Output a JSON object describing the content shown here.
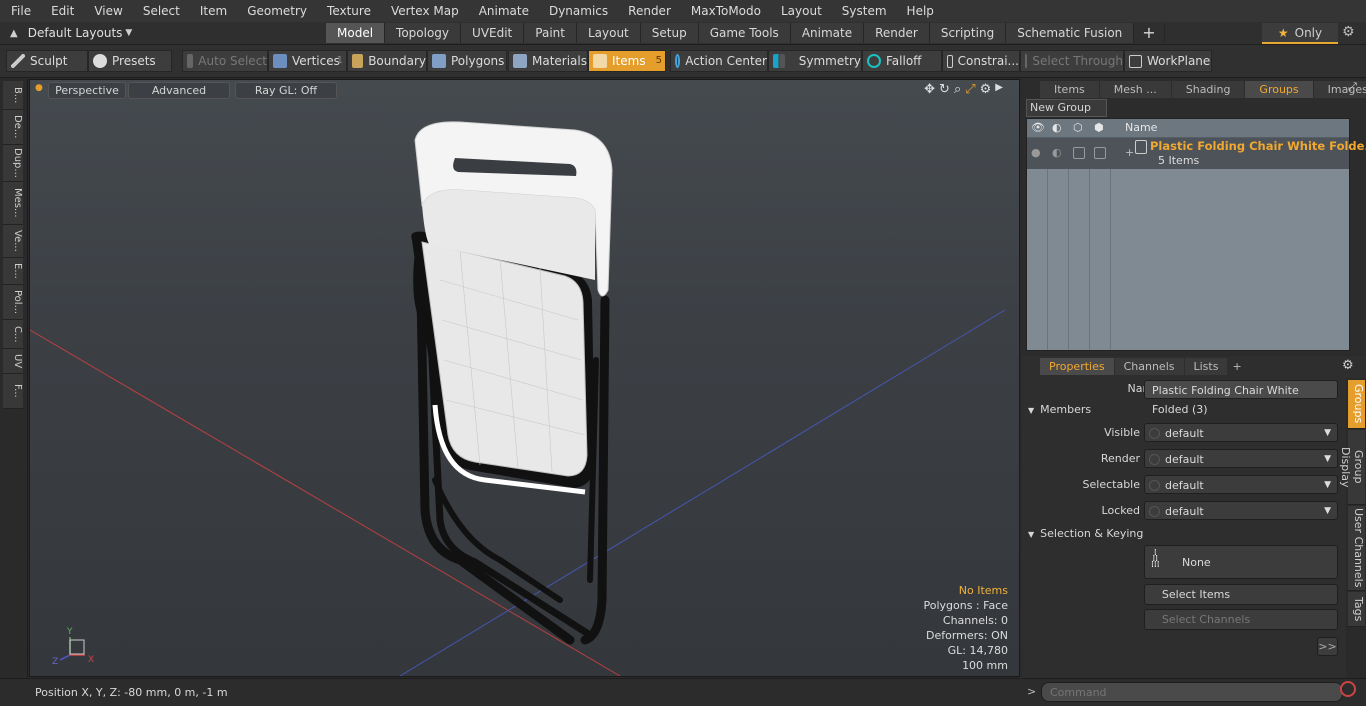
{
  "menu": [
    "File",
    "Edit",
    "View",
    "Select",
    "Item",
    "Geometry",
    "Texture",
    "Vertex Map",
    "Animate",
    "Dynamics",
    "Render",
    "MaxToModo",
    "Layout",
    "System",
    "Help"
  ],
  "layouts": {
    "label": "Default Layouts"
  },
  "mode_tabs": [
    "Model",
    "Topology",
    "UVEdit",
    "Paint",
    "Layout",
    "Setup",
    "Game Tools",
    "Animate",
    "Render",
    "Scripting",
    "Schematic Fusion"
  ],
  "only_label": "Only",
  "toolbar": {
    "sculpt": "Sculpt",
    "presets": "Presets",
    "auto_select": "Auto Select",
    "vertices": "Vertices",
    "vertices_count": "1",
    "boundary": "Boundary",
    "polygons": "Polygons",
    "materials": "Materials",
    "items": "Items",
    "items_count": "5",
    "action_center": "Action Center",
    "symmetry": "Symmetry",
    "falloff": "Falloff",
    "constraints": "Constrai...",
    "select_through": "Select Through",
    "workplane": "WorkPlane"
  },
  "left_tabs": [
    "B...",
    "De...",
    "Dup...",
    "Mes...",
    "Ve...",
    "E...",
    "Pol...",
    "C...",
    "UV",
    "F..."
  ],
  "viewport": {
    "perspective": "Perspective",
    "advanced": "Advanced",
    "raygl": "Ray GL: Off",
    "stats": {
      "no_items": "No Items",
      "polygons": "Polygons : Face",
      "channels": "Channels: 0",
      "deformers": "Deformers: ON",
      "gl": "GL: 14,780",
      "scale": "100 mm"
    },
    "axis": {
      "y": "Y",
      "x": "X",
      "z": "Z"
    }
  },
  "status": {
    "position": "Position X, Y, Z:  -80 mm, 0 m, -1 m"
  },
  "right_top": {
    "tabs": [
      "Items",
      "Mesh ...",
      "Shading",
      "Groups",
      "Images"
    ],
    "active_tab": "Groups",
    "new_group": "New Group",
    "name_header": "Name",
    "group_name": "Plastic Folding Chair White Folde...",
    "group_count": "5 Items"
  },
  "properties": {
    "tabs": [
      "Properties",
      "Channels",
      "Lists"
    ],
    "name_label": "Name",
    "name_value": "Plastic Folding Chair White Folded (3)",
    "members_header": "Members",
    "visible_label": "Visible",
    "visible_value": "default",
    "render_label": "Render",
    "render_value": "default",
    "selectable_label": "Selectable",
    "selectable_value": "default",
    "locked_label": "Locked",
    "locked_value": "default",
    "selkey_header": "Selection & Keying",
    "none_label": "None",
    "select_items": "Select Items",
    "select_channels": "Select Channels",
    "more": ">>",
    "side_tabs": [
      "Groups",
      "Group Display",
      "User Channels",
      "Tags"
    ]
  },
  "command": {
    "placeholder": "Command"
  },
  "colors": {
    "accent": "#e59d2c",
    "group_name": "#f0a830"
  }
}
